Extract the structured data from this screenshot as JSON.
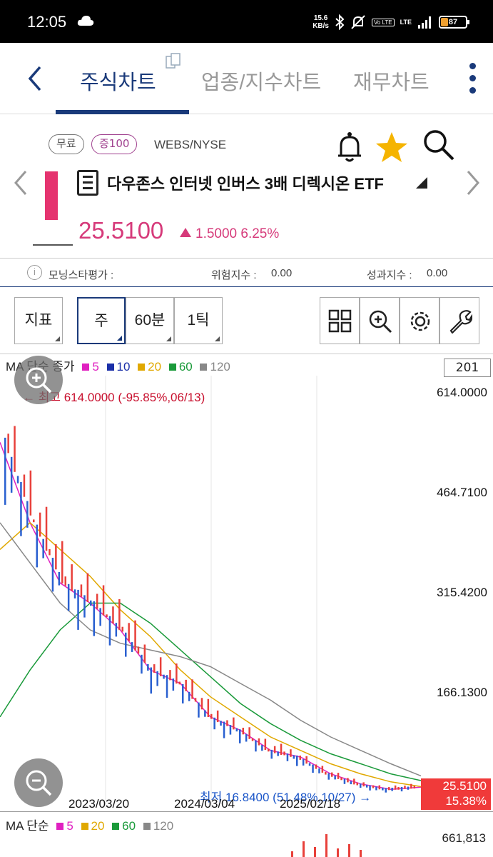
{
  "status": {
    "time": "12:05",
    "net_speed_top": "15.6",
    "net_speed_bottom": "KB/s",
    "volte": "Vo LTE",
    "lte": "LTE",
    "battery": "87"
  },
  "nav": {
    "tabs": [
      {
        "label": "주식차트",
        "active": true
      },
      {
        "label": "업종/지수차트",
        "active": false
      },
      {
        "label": "재무차트",
        "active": false
      }
    ]
  },
  "stock": {
    "badge_free": "무료",
    "badge_margin": "증100",
    "exchange": "WEBS/NYSE",
    "name": "다우존스 인터넷 인버스 3배 디렉시온 ETF",
    "price": "25.5100",
    "change": "1.5000 6.25%"
  },
  "ratings": {
    "morningstar_label": "모닝스타평가 :",
    "risk_label": "위험지수 :",
    "risk_value": "0.00",
    "perf_label": "성과지수 :",
    "perf_value": "0.00"
  },
  "toolbar": {
    "indicator": "지표",
    "period_week": "주",
    "period_60min": "60분",
    "period_tick": "1틱"
  },
  "chart": {
    "ma_title": "MA 단순 종가",
    "ma_items": [
      {
        "label": "5",
        "color": "#e020c0"
      },
      {
        "label": "10",
        "color": "#1a2fa8"
      },
      {
        "label": "20",
        "color": "#e0a800"
      },
      {
        "label": "60",
        "color": "#1a9a3a"
      },
      {
        "label": "120",
        "color": "#888888"
      }
    ],
    "count": "201",
    "y_ticks": [
      "614.0000",
      "464.7100",
      "315.4200",
      "166.1300"
    ],
    "high_annotation": "← 최고 614.0000 (-95.85%,06/13)",
    "low_annotation": "최저 16.8400 (51.48%,10/27) →",
    "x_ticks": [
      "2023/03/20",
      "2024/03/04",
      "2025/02/18"
    ],
    "last_price": "25.5100",
    "last_pct": "15.38%",
    "vol_title": "MA 단순",
    "vol_items": [
      {
        "label": "5",
        "color": "#e020c0"
      },
      {
        "label": "20",
        "color": "#e0a800"
      },
      {
        "label": "60",
        "color": "#1a9a3a"
      },
      {
        "label": "120",
        "color": "#888888"
      }
    ],
    "vol_max": "661,813"
  },
  "chart_data": {
    "type": "line",
    "title": "",
    "xlabel": "",
    "ylabel": "",
    "x_tick_labels": [
      "2023/03/20",
      "2024/03/04",
      "2025/02/18"
    ],
    "ylim": [
      16.84,
      614.0
    ],
    "series": [
      {
        "name": "MA 5",
        "values": [
          540,
          420,
          330,
          300,
          260,
          200,
          180,
          130,
          110,
          80,
          70,
          45,
          30,
          22,
          25
        ]
      },
      {
        "name": "MA 20",
        "values": [
          380,
          420,
          380,
          340,
          290,
          250,
          200,
          160,
          130,
          100,
          80,
          60,
          45,
          33,
          26
        ]
      },
      {
        "name": "MA 60",
        "values": [
          130,
          200,
          260,
          300,
          300,
          270,
          230,
          190,
          150,
          120,
          95,
          75,
          60,
          45,
          35
        ]
      },
      {
        "name": "MA 120",
        "values": [
          420,
          360,
          300,
          260,
          240,
          230,
          220,
          205,
          180,
          155,
          125,
          100,
          80,
          60,
          42
        ]
      }
    ]
  }
}
